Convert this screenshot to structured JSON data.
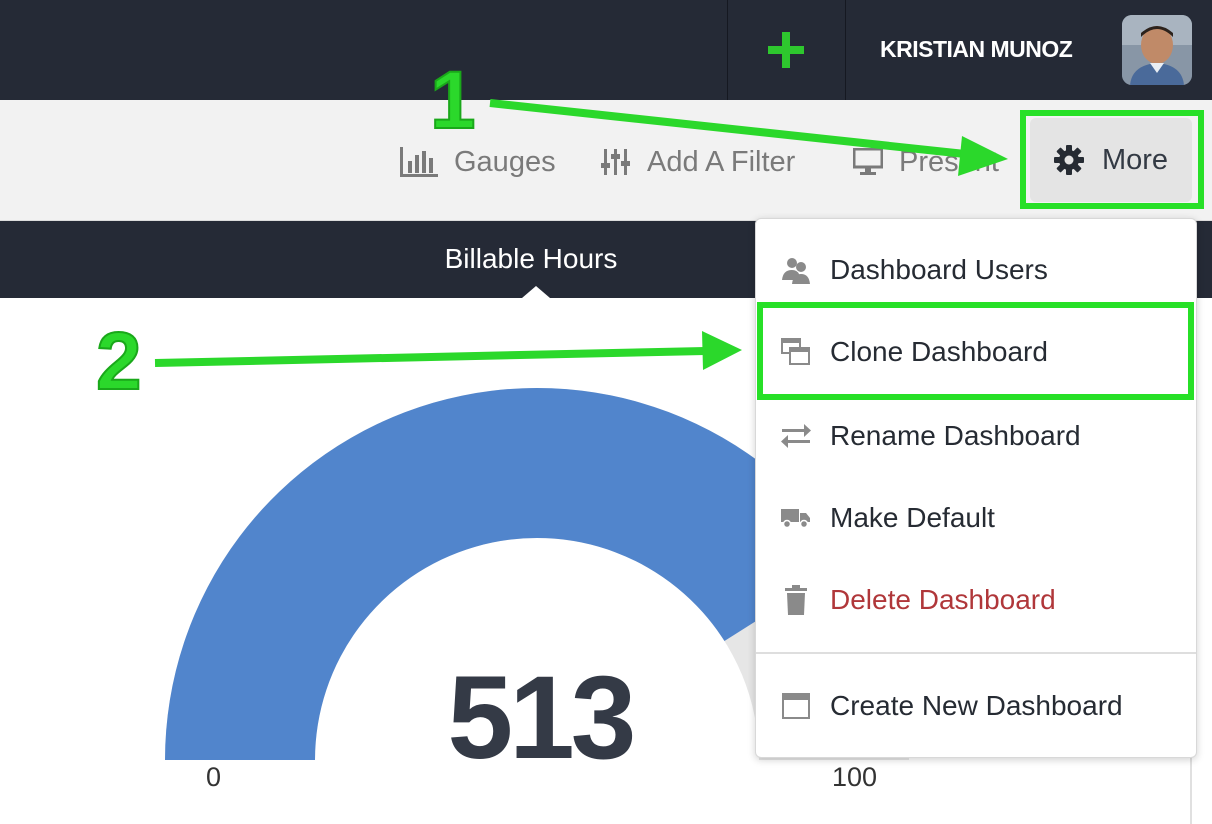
{
  "header": {
    "add_symbol": "+",
    "user_name": "KRISTIAN MUNOZ"
  },
  "toolbar": {
    "gauges_label": "Gauges",
    "filter_label": "Add A Filter",
    "present_label": "Present",
    "more_label": "More"
  },
  "tab": {
    "title": "Billable Hours"
  },
  "gauge": {
    "value": "513",
    "min": "0",
    "max": "100",
    "fill_fraction": 0.82,
    "color": "#5185cc"
  },
  "menu": {
    "items": [
      {
        "label": "Dashboard Users",
        "icon": "users-icon"
      },
      {
        "label": "Clone Dashboard",
        "icon": "clone-icon"
      },
      {
        "label": "Rename Dashboard",
        "icon": "swap-arrows-icon"
      },
      {
        "label": "Make Default",
        "icon": "truck-icon"
      },
      {
        "label": "Delete Dashboard",
        "icon": "trash-icon",
        "color": "#b0373a"
      },
      {
        "label": "Create New Dashboard",
        "icon": "window-icon"
      }
    ]
  },
  "annotations": {
    "step1": "1",
    "step2": "2",
    "color": "#2bd82b"
  }
}
